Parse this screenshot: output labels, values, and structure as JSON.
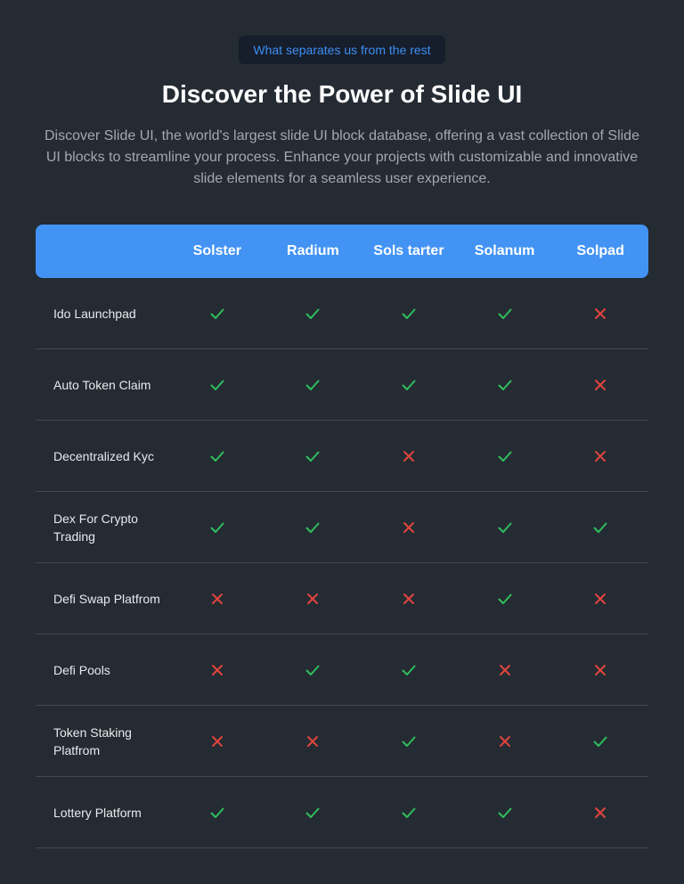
{
  "badge": "What separates us from the rest",
  "title": "Discover the Power of Slide UI",
  "subtitle": "Discover Slide UI, the world's largest slide UI block database, offering a vast collection of Slide UI blocks to streamline your process. Enhance your projects with customizable and innovative slide elements for a seamless user experience.",
  "colors": {
    "background": "#252b33",
    "header": "#4393f4",
    "check": "#2fbf5c",
    "cross": "#e2443e",
    "badge_text": "#3e8ff2"
  },
  "table": {
    "columns": [
      "Solster",
      "Radium",
      "Sols tarter",
      "Solanum",
      "Solpad"
    ],
    "rows": [
      {
        "label": "Ido Launchpad",
        "values": [
          true,
          true,
          true,
          true,
          false
        ]
      },
      {
        "label": "Auto Token Claim",
        "values": [
          true,
          true,
          true,
          true,
          false
        ]
      },
      {
        "label": "Decentralized Kyc",
        "values": [
          true,
          true,
          false,
          true,
          false
        ]
      },
      {
        "label": "Dex For Crypto Trading",
        "values": [
          true,
          true,
          false,
          true,
          true
        ]
      },
      {
        "label": "Defi Swap Platfrom",
        "values": [
          false,
          false,
          false,
          true,
          false
        ]
      },
      {
        "label": "Defi Pools",
        "values": [
          false,
          true,
          true,
          false,
          false
        ]
      },
      {
        "label": "Token Staking Platfrom",
        "values": [
          false,
          false,
          true,
          false,
          true
        ]
      },
      {
        "label": "Lottery Platform",
        "values": [
          true,
          true,
          true,
          true,
          false
        ]
      }
    ]
  }
}
